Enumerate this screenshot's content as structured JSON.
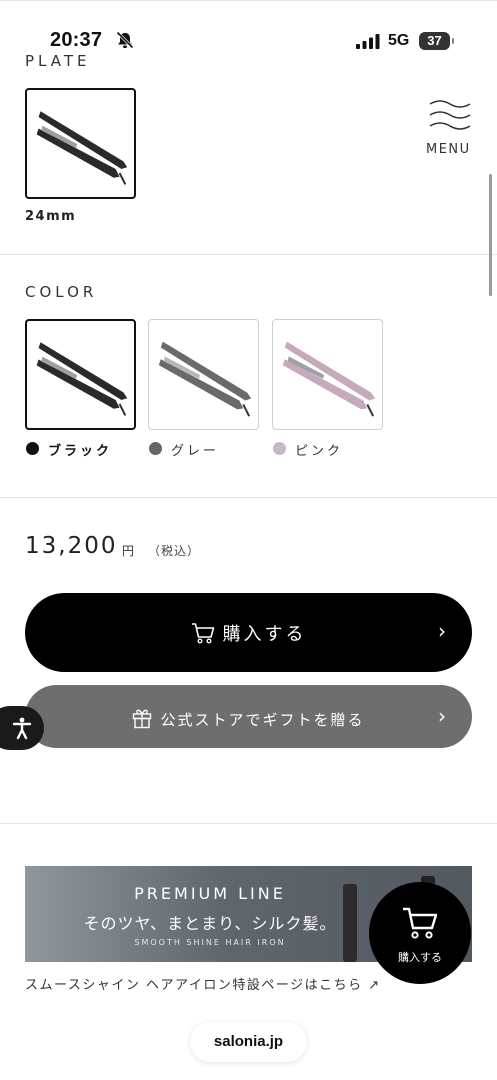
{
  "status_bar": {
    "time": "20:37",
    "network": "5G",
    "battery": "37"
  },
  "menu": {
    "label": "MENU"
  },
  "plate": {
    "label": "PLATE",
    "options": [
      {
        "label": "24mm",
        "selected": true
      }
    ]
  },
  "color": {
    "label": "COLOR",
    "options": [
      {
        "label": "ブラック",
        "swatch": "#111111",
        "iron": "#2a2a2a",
        "selected": true
      },
      {
        "label": "グレー",
        "swatch": "#666666",
        "iron": "#6a6a6a",
        "selected": false
      },
      {
        "label": "ピンク",
        "swatch": "#c9b4c8",
        "iron": "#c6a9bd",
        "selected": false
      }
    ]
  },
  "price": {
    "amount": "13,200",
    "unit": "円",
    "tax": "（税込）"
  },
  "buttons": {
    "buy": "購入する",
    "gift": "公式ストアでギフトを贈る"
  },
  "banner": {
    "title": "PREMIUM LINE",
    "subtitle": "そのツヤ、まとまり、シルク髪。",
    "tagline": "SMOOTH SHINE HAIR IRON"
  },
  "special_link": "スムースシャイン ヘアアイロン特設ページはこちら ↗",
  "fab": {
    "label": "購入する"
  },
  "browser": {
    "url": "salonia.jp"
  }
}
